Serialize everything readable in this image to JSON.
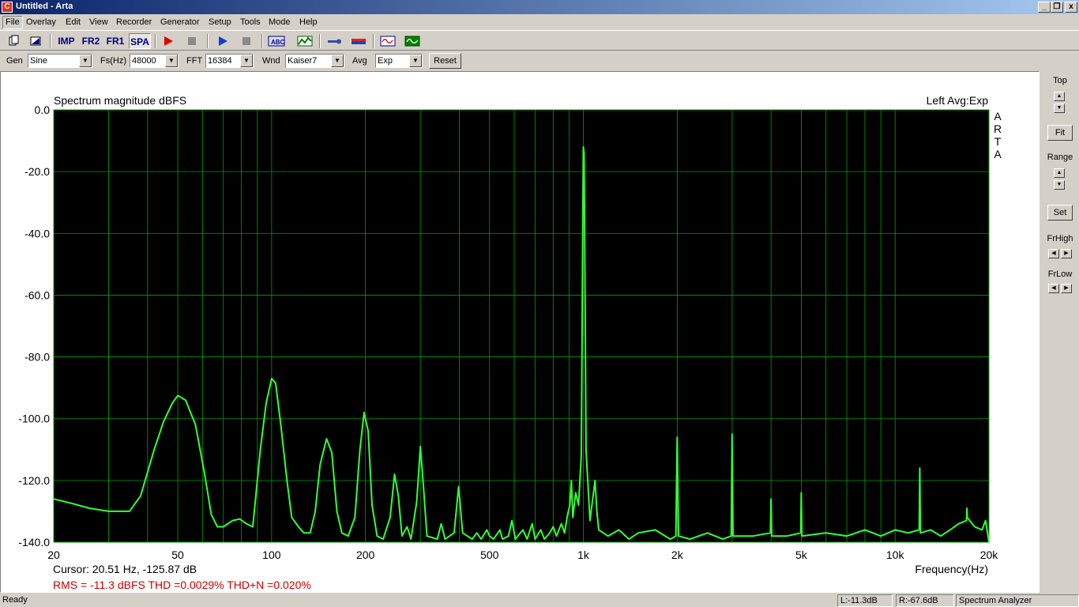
{
  "window": {
    "title": "Untitled - Arta",
    "app_icon": "C",
    "controls": [
      "_",
      "❐",
      "x"
    ]
  },
  "menu": [
    "File",
    "Overlay",
    "Edit",
    "View",
    "Recorder",
    "Generator",
    "Setup",
    "Tools",
    "Mode",
    "Help"
  ],
  "toolbar": {
    "mode_buttons": [
      {
        "label": "IMP",
        "name": "impulse-mode-button"
      },
      {
        "label": "FR2",
        "name": "fr2-mode-button"
      },
      {
        "label": "FR1",
        "name": "fr1-mode-button"
      },
      {
        "label": "SPA",
        "name": "spectrum-mode-button",
        "active": true
      }
    ],
    "icons": [
      "new-file-icon",
      "open-file-icon",
      "record-red-icon",
      "stop-icon",
      "play-blue-icon",
      "stop-icon",
      "abc-icon",
      "graph-icon",
      "wrench-icon",
      "bar-icon",
      "waveform-icon",
      "oscilloscope-icon"
    ]
  },
  "params": {
    "gen_label": "Gen",
    "gen_value": "Sine",
    "fs_label": "Fs(Hz)",
    "fs_value": "48000",
    "fft_label": "FFT",
    "fft_value": "16384",
    "wnd_label": "Wnd",
    "wnd_value": "Kaiser7",
    "avg_label": "Avg",
    "avg_value": "Exp",
    "reset_label": "Reset"
  },
  "side": {
    "top_label": "Top",
    "fit_label": "Fit",
    "range_label": "Range",
    "set_label": "Set",
    "frhigh_label": "FrHigh",
    "frlow_label": "FrLow"
  },
  "chart_header": {
    "title": "Spectrum magnitude dBFS",
    "right_info": "Left  Avg:Exp",
    "brand": [
      "A",
      "R",
      "T",
      "A"
    ]
  },
  "readouts": {
    "cursor": "Cursor: 20.51 Hz, -125.87 dB",
    "xlabel": "Frequency(Hz)",
    "stats": "RMS =  -11.3 dBFS   THD =0.0029%   THD+N =0.020%"
  },
  "status": {
    "ready": "Ready",
    "left": "L:-11.3dB",
    "right": "R:-67.6dB",
    "mode": "Spectrum Analyzer"
  },
  "colors": {
    "plot_bg": "#000000",
    "grid": "#00a000",
    "trace": "#33ff33",
    "stats_text": "#cc0000"
  },
  "chart_data": {
    "type": "line",
    "title": "Spectrum magnitude dBFS",
    "xlabel": "Frequency(Hz)",
    "ylabel": "",
    "x_scale": "log",
    "xlim": [
      20,
      20000
    ],
    "ylim": [
      -140,
      0
    ],
    "grid": true,
    "x_ticks": [
      {
        "v": 20,
        "label": "20"
      },
      {
        "v": 50,
        "label": "50"
      },
      {
        "v": 100,
        "label": "100"
      },
      {
        "v": 200,
        "label": "200"
      },
      {
        "v": 500,
        "label": "500"
      },
      {
        "v": 1000,
        "label": "1k"
      },
      {
        "v": 2000,
        "label": "2k"
      },
      {
        "v": 5000,
        "label": "5k"
      },
      {
        "v": 10000,
        "label": "10k"
      },
      {
        "v": 20000,
        "label": "20k"
      }
    ],
    "y_ticks": [
      {
        "v": 0,
        "label": "0.0"
      },
      {
        "v": -20,
        "label": "-20.0"
      },
      {
        "v": -40,
        "label": "-40.0"
      },
      {
        "v": -60,
        "label": "-60.0"
      },
      {
        "v": -80,
        "label": "-80.0"
      },
      {
        "v": -100,
        "label": "-100.0"
      },
      {
        "v": -120,
        "label": "-120.0"
      },
      {
        "v": -140,
        "label": "-140.0"
      }
    ],
    "series": [
      {
        "values": [
          [
            20,
            -126
          ],
          [
            23,
            -127.5
          ],
          [
            26,
            -129
          ],
          [
            30,
            -130
          ],
          [
            35,
            -130
          ],
          [
            38,
            -125
          ],
          [
            42,
            -110
          ],
          [
            45,
            -101
          ],
          [
            48,
            -95
          ],
          [
            50,
            -92.5
          ],
          [
            53,
            -94
          ],
          [
            57,
            -102
          ],
          [
            61,
            -118
          ],
          [
            64,
            -131
          ],
          [
            67,
            -135
          ],
          [
            70,
            -135
          ],
          [
            75,
            -133
          ],
          [
            79,
            -132.5
          ],
          [
            83,
            -134
          ],
          [
            87,
            -135
          ],
          [
            92,
            -110
          ],
          [
            96,
            -95
          ],
          [
            100,
            -87
          ],
          [
            103,
            -88.5
          ],
          [
            107,
            -102
          ],
          [
            112,
            -120
          ],
          [
            116,
            -132
          ],
          [
            122,
            -135
          ],
          [
            127,
            -137
          ],
          [
            133,
            -137
          ],
          [
            138,
            -130
          ],
          [
            143,
            -115
          ],
          [
            150,
            -106.5
          ],
          [
            156,
            -111
          ],
          [
            162,
            -130
          ],
          [
            168,
            -137
          ],
          [
            176,
            -138
          ],
          [
            185,
            -132
          ],
          [
            192,
            -110
          ],
          [
            198,
            -98
          ],
          [
            204,
            -104
          ],
          [
            210,
            -128
          ],
          [
            218,
            -138
          ],
          [
            228,
            -139
          ],
          [
            240,
            -132
          ],
          [
            248,
            -118
          ],
          [
            255,
            -125
          ],
          [
            262,
            -138
          ],
          [
            272,
            -135
          ],
          [
            280,
            -139
          ],
          [
            292,
            -127
          ],
          [
            300,
            -109
          ],
          [
            307,
            -122
          ],
          [
            315,
            -138
          ],
          [
            340,
            -139
          ],
          [
            350,
            -134
          ],
          [
            360,
            -139
          ],
          [
            385,
            -137
          ],
          [
            398,
            -122
          ],
          [
            410,
            -137
          ],
          [
            440,
            -139
          ],
          [
            455,
            -137
          ],
          [
            470,
            -139
          ],
          [
            490,
            -136
          ],
          [
            500,
            -138
          ],
          [
            515,
            -139
          ],
          [
            540,
            -136
          ],
          [
            550,
            -139
          ],
          [
            575,
            -138
          ],
          [
            590,
            -133
          ],
          [
            605,
            -139
          ],
          [
            640,
            -136
          ],
          [
            660,
            -139
          ],
          [
            685,
            -134
          ],
          [
            700,
            -139
          ],
          [
            730,
            -136
          ],
          [
            750,
            -139
          ],
          [
            780,
            -137
          ],
          [
            800,
            -135
          ],
          [
            820,
            -138
          ],
          [
            850,
            -134
          ],
          [
            870,
            -137
          ],
          [
            890,
            -131
          ],
          [
            905,
            -128
          ],
          [
            915,
            -120
          ],
          [
            925,
            -132
          ],
          [
            945,
            -124
          ],
          [
            965,
            -128
          ],
          [
            985,
            -112
          ],
          [
            995,
            -40
          ],
          [
            1000,
            -12
          ],
          [
            1005,
            -14
          ],
          [
            1010,
            -40
          ],
          [
            1020,
            -110
          ],
          [
            1050,
            -133
          ],
          [
            1090,
            -120
          ],
          [
            1105,
            -130
          ],
          [
            1120,
            -136
          ],
          [
            1200,
            -138
          ],
          [
            1300,
            -136
          ],
          [
            1400,
            -139
          ],
          [
            1500,
            -137
          ],
          [
            1700,
            -136
          ],
          [
            1900,
            -139
          ],
          [
            1980,
            -138
          ],
          [
            2000,
            -106
          ],
          [
            2020,
            -138
          ],
          [
            2200,
            -139
          ],
          [
            2500,
            -137
          ],
          [
            2800,
            -139
          ],
          [
            2980,
            -138
          ],
          [
            3000,
            -105
          ],
          [
            3020,
            -138
          ],
          [
            3500,
            -138
          ],
          [
            3980,
            -137
          ],
          [
            4000,
            -126
          ],
          [
            4020,
            -138
          ],
          [
            4500,
            -138
          ],
          [
            4980,
            -137
          ],
          [
            5000,
            -124
          ],
          [
            5020,
            -138
          ],
          [
            6000,
            -137
          ],
          [
            7000,
            -138
          ],
          [
            8000,
            -136
          ],
          [
            9000,
            -138
          ],
          [
            10000,
            -136
          ],
          [
            11000,
            -137
          ],
          [
            11950,
            -136
          ],
          [
            12000,
            -116
          ],
          [
            12050,
            -137
          ],
          [
            13000,
            -136
          ],
          [
            14000,
            -138
          ],
          [
            15000,
            -136
          ],
          [
            16000,
            -134
          ],
          [
            16950,
            -133
          ],
          [
            17000,
            -129
          ],
          [
            17050,
            -132
          ],
          [
            18000,
            -135
          ],
          [
            19000,
            -136
          ],
          [
            19500,
            -133
          ],
          [
            20000,
            -140
          ]
        ]
      }
    ]
  }
}
